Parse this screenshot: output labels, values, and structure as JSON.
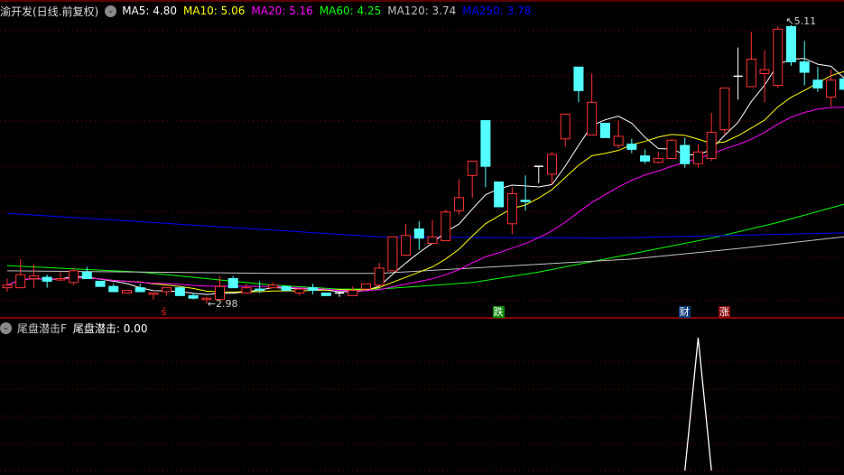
{
  "header": {
    "title": "渝开发(日线.前复权)",
    "ma_labels": [
      {
        "text": "MA5: 4.80",
        "color": "#ffffff"
      },
      {
        "text": "MA10: 5.06",
        "color": "#ffff00"
      },
      {
        "text": "MA20: 5.16",
        "color": "#ff00ff"
      },
      {
        "text": "MA60: 4.25",
        "color": "#00ff00"
      },
      {
        "text": "MA120: 3.74",
        "color": "#c0c0c0"
      },
      {
        "text": "MA250: 3.78",
        "color": "#0000ff"
      }
    ]
  },
  "indicator_header": {
    "name": "尾盘潜击F",
    "value_label": "尾盘潜击: 0.00"
  },
  "signals": [
    {
      "index": 12,
      "text": "ŝ",
      "color": "#ff2020",
      "bg": "transparent"
    },
    {
      "index": 37,
      "text": "跌",
      "color": "#ffffff",
      "bg": "#0a8a0a"
    },
    {
      "index": 51,
      "text": "财",
      "color": "#ffffff",
      "bg": "#0a3a7a"
    },
    {
      "index": 54,
      "text": "涨",
      "color": "#ffffff",
      "bg": "#8a0a0a"
    }
  ],
  "annotations": {
    "high_label": "5.11",
    "low_label": "2.98"
  },
  "colors": {
    "up": "#ff3232",
    "down": "#54ffff",
    "doji": "#ffffff",
    "grid": "#8b0000",
    "divider": "#b00000"
  },
  "chart_data": {
    "type": "candlestick",
    "price_range": [
      2.93,
      5.2
    ],
    "high_marker": {
      "index": 59,
      "value": 5.11
    },
    "low_marker": {
      "index": 15,
      "value": 2.98
    },
    "candles_ohlc": [
      [
        3.1,
        3.17,
        3.07,
        3.12
      ],
      [
        3.1,
        3.32,
        3.1,
        3.2
      ],
      [
        3.17,
        3.28,
        3.1,
        3.19
      ],
      [
        3.18,
        3.2,
        3.1,
        3.15
      ],
      [
        3.16,
        3.22,
        3.15,
        3.17
      ],
      [
        3.14,
        3.25,
        3.12,
        3.23
      ],
      [
        3.22,
        3.26,
        3.17,
        3.17
      ],
      [
        3.15,
        3.15,
        3.11,
        3.11
      ],
      [
        3.11,
        3.13,
        3.07,
        3.07
      ],
      [
        3.06,
        3.08,
        3.06,
        3.08
      ],
      [
        3.1,
        3.13,
        3.07,
        3.07
      ],
      [
        3.05,
        3.06,
        3.01,
        3.06
      ],
      [
        3.07,
        3.1,
        3.04,
        3.1
      ],
      [
        3.1,
        3.11,
        3.04,
        3.04
      ],
      [
        3.04,
        3.06,
        3.01,
        3.02
      ],
      [
        3.01,
        3.03,
        2.98,
        3.02
      ],
      [
        3.01,
        3.19,
        3.01,
        3.11
      ],
      [
        3.17,
        3.19,
        3.1,
        3.1
      ],
      [
        3.06,
        3.13,
        3.06,
        3.1
      ],
      [
        3.09,
        3.15,
        3.06,
        3.08
      ],
      [
        3.1,
        3.14,
        3.1,
        3.12
      ],
      [
        3.11,
        3.11,
        3.08,
        3.08
      ],
      [
        3.06,
        3.09,
        3.04,
        3.09
      ],
      [
        3.1,
        3.13,
        3.05,
        3.08
      ],
      [
        3.06,
        3.06,
        3.04,
        3.04
      ],
      [
        3.06,
        3.07,
        3.03,
        3.06
      ],
      [
        3.04,
        3.11,
        3.04,
        3.08
      ],
      [
        3.09,
        3.13,
        3.09,
        3.13
      ],
      [
        3.12,
        3.29,
        3.12,
        3.25
      ],
      [
        3.23,
        3.49,
        3.23,
        3.49
      ],
      [
        3.35,
        3.59,
        3.35,
        3.5
      ],
      [
        3.55,
        3.61,
        3.39,
        3.48
      ],
      [
        3.44,
        3.62,
        3.44,
        3.49
      ],
      [
        3.46,
        3.7,
        3.46,
        3.68
      ],
      [
        3.69,
        3.93,
        3.66,
        3.79
      ],
      [
        3.96,
        4.07,
        3.79,
        4.07
      ],
      [
        4.38,
        4.38,
        3.87,
        4.03
      ],
      [
        3.91,
        3.91,
        3.72,
        3.72
      ],
      [
        3.59,
        3.87,
        3.51,
        3.82
      ],
      [
        3.77,
        3.96,
        3.69,
        3.76
      ],
      [
        4.03,
        4.03,
        3.9,
        4.03
      ],
      [
        3.97,
        4.14,
        3.89,
        4.12
      ],
      [
        4.24,
        4.43,
        4.18,
        4.43
      ],
      [
        4.79,
        4.79,
        4.52,
        4.61
      ],
      [
        4.27,
        4.74,
        4.27,
        4.52
      ],
      [
        4.36,
        4.36,
        4.25,
        4.25
      ],
      [
        4.19,
        4.38,
        4.17,
        4.26
      ],
      [
        4.2,
        4.24,
        4.13,
        4.16
      ],
      [
        4.11,
        4.16,
        4.05,
        4.07
      ],
      [
        4.06,
        4.14,
        4.05,
        4.09
      ],
      [
        4.09,
        4.24,
        4.09,
        4.23
      ],
      [
        4.19,
        4.25,
        4.02,
        4.05
      ],
      [
        4.05,
        4.2,
        4.02,
        4.14
      ],
      [
        4.09,
        4.44,
        4.07,
        4.29
      ],
      [
        4.31,
        4.63,
        4.27,
        4.63
      ],
      [
        4.72,
        4.94,
        4.54,
        4.72
      ],
      [
        4.64,
        5.06,
        4.64,
        4.85
      ],
      [
        4.74,
        4.92,
        4.52,
        4.77
      ],
      [
        4.65,
        5.1,
        4.63,
        5.08
      ],
      [
        5.1,
        5.11,
        4.8,
        4.83
      ],
      [
        4.83,
        4.99,
        4.65,
        4.75
      ],
      [
        4.69,
        4.79,
        4.6,
        4.63
      ],
      [
        4.56,
        4.77,
        4.49,
        4.69
      ],
      [
        4.7,
        4.75,
        4.6,
        4.62
      ]
    ],
    "computed_ma": [
      {
        "name": "MA5",
        "period": 5,
        "color": "#ffffff"
      },
      {
        "name": "MA10",
        "period": 10,
        "color": "#ffff00"
      },
      {
        "name": "MA20",
        "period": 20,
        "color": "#ff00ff"
      }
    ],
    "long_ma": [
      {
        "name": "MA60",
        "color": "#00ff00",
        "points": [
          [
            0,
            3.27
          ],
          [
            10,
            3.22
          ],
          [
            15,
            3.17
          ],
          [
            20,
            3.12
          ],
          [
            25,
            3.09
          ],
          [
            28,
            3.09
          ],
          [
            35,
            3.14
          ],
          [
            40,
            3.22
          ],
          [
            45,
            3.32
          ],
          [
            50,
            3.42
          ],
          [
            53,
            3.48
          ],
          [
            58,
            3.6
          ],
          [
            63,
            3.74
          ]
        ]
      },
      {
        "name": "MA120",
        "color": "#c0c0c0",
        "points": [
          [
            0,
            3.23
          ],
          [
            10,
            3.22
          ],
          [
            20,
            3.21
          ],
          [
            28,
            3.21
          ],
          [
            40,
            3.28
          ],
          [
            47,
            3.32
          ],
          [
            55,
            3.4
          ],
          [
            63,
            3.49
          ]
        ]
      },
      {
        "name": "MA250",
        "color": "#0000ff",
        "points": [
          [
            0,
            3.67
          ],
          [
            14,
            3.58
          ],
          [
            28,
            3.49
          ],
          [
            45,
            3.48
          ],
          [
            63,
            3.52
          ]
        ]
      }
    ],
    "indicator": {
      "name": "尾盘潜击",
      "range": [
        0,
        1
      ],
      "spikes": [
        {
          "index": 52,
          "value": 1
        }
      ],
      "baseline": 0
    }
  }
}
